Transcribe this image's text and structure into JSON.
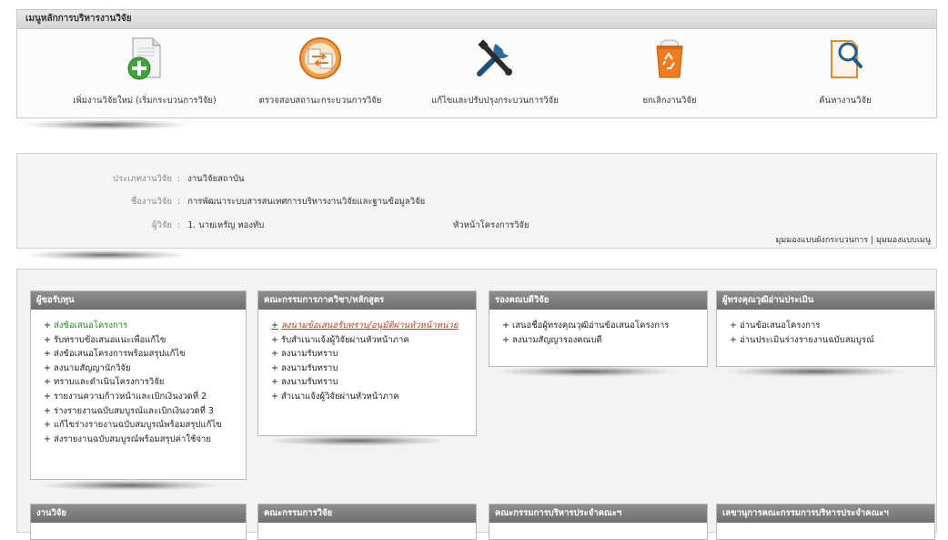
{
  "top_menu": {
    "title": "เมนูหลักการบริหารงานวิจัย",
    "items": [
      {
        "label": "เพิ่มงานวิจัยใหม่ (เริ่มกระบวนการวิจัย)",
        "icon": "document-add-icon"
      },
      {
        "label": "ตรวจสอบสถานะกระบวนการวิจัย",
        "icon": "swap-arrows-icon"
      },
      {
        "label": "แก้ไขและปรับปรุงกระบวนการวิจัย",
        "icon": "tools-icon"
      },
      {
        "label": "ยกเลิกงานวิจัย",
        "icon": "recycle-bin-icon"
      },
      {
        "label": "ค้นหางานวิจัย",
        "icon": "search-document-icon"
      }
    ]
  },
  "info": {
    "type_label": "ประเภทงานวิจัย",
    "type_value": "งานวิจัยสถาบัน",
    "name_label": "ชื่องานวิจัย",
    "name_value": "การพัฒนาระบบสารสนเทศการบริหารงานวิจัยและฐานข้อมูลวิจัย",
    "researcher_label": "ผู้วิจัย",
    "researcher_value": "1. นายเหรัญ ทองทับ",
    "role_value": "หัวหน้าโครงการวิจัย",
    "view_process": "มุมมองแบบผังกระบวนการ",
    "view_sep": "|",
    "view_menu": "มุมมองแบบเมนู"
  },
  "panels": [
    {
      "title": "ผู้ขอรับทุน",
      "items": [
        {
          "text": "ส่งข้อเสนอโครงการ",
          "style": "green"
        },
        {
          "text": "รับทราบข้อเสนอแนะเพื่อแก้ไข",
          "style": "normal"
        },
        {
          "text": "ส่งข้อเสนอโครงการพร้อมสรุปแก้ไข",
          "style": "normal"
        },
        {
          "text": "ลงนามสัญญานักวิจัย",
          "style": "normal"
        },
        {
          "text": "ทราบและดำเนินโครงการวิจัย",
          "style": "normal"
        },
        {
          "text": "รายงานความก้าวหน้าและเบิกเงินงวดที่ 2",
          "style": "normal"
        },
        {
          "text": "ร่างรายงานฉบับสมบูรณ์และเบิกเงินงวดที่ 3",
          "style": "normal"
        },
        {
          "text": "แก้ไขร่างรายงานฉบับสมบูรณ์พร้อมสรุปแก้ไข",
          "style": "normal"
        },
        {
          "text": "ส่งรายงานฉบับสมบูรณ์พร้อมสรุปค่าใช้จ่าย",
          "style": "normal"
        }
      ]
    },
    {
      "title": "คณะกรรมการภาควิชา/หลักสูตร",
      "items": [
        {
          "text": "ลงนามข้อเสนอรับทราบ/อนุมัติผ่านหัวหน้าหน่วย",
          "style": "red"
        },
        {
          "text": "รับสำเนาแจ้งผู้วิจัยผ่านหัวหน้าภาค",
          "style": "normal"
        },
        {
          "text": "ลงนามรับทราบ",
          "style": "normal"
        },
        {
          "text": "ลงนามรับทราบ",
          "style": "normal"
        },
        {
          "text": "ลงนามรับทราบ",
          "style": "normal"
        },
        {
          "text": "สำเนาแจ้งผู้วิจัยผ่านหัวหน้าภาค",
          "style": "normal"
        }
      ]
    },
    {
      "title": "รองคณบดีวิจัย",
      "items": [
        {
          "text": "เสนอชื่อผู้ทรงคุณวุฒิอ่านข้อเสนอโครงการ",
          "style": "normal"
        },
        {
          "text": "ลงนามสัญญารองคณบดี",
          "style": "normal"
        }
      ]
    },
    {
      "title": "ผู้ทรงคุณวุฒิอ่านประเมิน",
      "items": [
        {
          "text": "อ่านข้อเสนอโครงการ",
          "style": "normal"
        },
        {
          "text": "อ่านประเมินร่างรายงานฉบับสมบูรณ์",
          "style": "normal"
        }
      ]
    },
    {
      "title": "งานวิจัย",
      "items": []
    },
    {
      "title": "คณะกรรมการวิจัย",
      "items": []
    },
    {
      "title": "คณะกรรมการบริหารประจำคณะฯ",
      "items": []
    },
    {
      "title": "เลขานุการคณะกรรมการบริหารประจำคณะฯ",
      "items": []
    }
  ]
}
